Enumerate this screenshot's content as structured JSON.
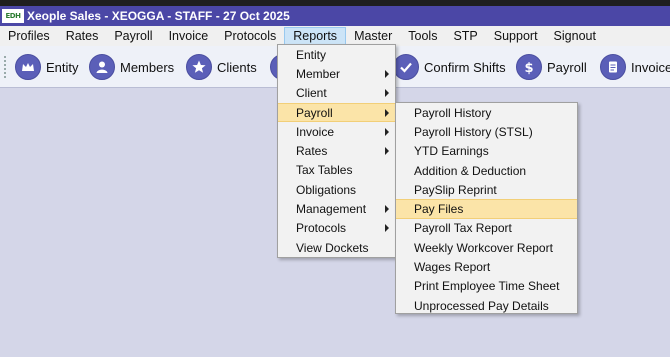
{
  "window": {
    "title": "Xeople Sales - XEOGGA - STAFF - 27 Oct 2025",
    "logo_text": "EDH"
  },
  "menubar": [
    {
      "label": "Profiles"
    },
    {
      "label": "Rates"
    },
    {
      "label": "Payroll"
    },
    {
      "label": "Invoice"
    },
    {
      "label": "Protocols"
    },
    {
      "label": "Reports"
    },
    {
      "label": "Master"
    },
    {
      "label": "Tools"
    },
    {
      "label": "STP"
    },
    {
      "label": "Support"
    },
    {
      "label": "Signout"
    }
  ],
  "toolbar": {
    "entity": "Entity",
    "members": "Members",
    "clients": "Clients",
    "confirm_shifts": "Confirm Shifts",
    "payroll": "Payroll",
    "invoice": "Invoice"
  },
  "reports_menu": [
    {
      "label": "Entity"
    },
    {
      "label": "Member"
    },
    {
      "label": "Client"
    },
    {
      "label": "Payroll"
    },
    {
      "label": "Invoice"
    },
    {
      "label": "Rates"
    },
    {
      "label": "Tax Tables"
    },
    {
      "label": "Obligations"
    },
    {
      "label": "Management"
    },
    {
      "label": "Protocols"
    },
    {
      "label": "View Dockets"
    }
  ],
  "payroll_submenu": [
    {
      "label": "Payroll History"
    },
    {
      "label": "Payroll History (STSL)"
    },
    {
      "label": "YTD Earnings"
    },
    {
      "label": "Addition & Deduction"
    },
    {
      "label": "PaySlip Reprint"
    },
    {
      "label": "Pay Files"
    },
    {
      "label": "Payroll Tax Report"
    },
    {
      "label": "Weekly Workcover Report"
    },
    {
      "label": "Wages Report"
    },
    {
      "label": "Print Employee Time Sheet"
    },
    {
      "label": "Unprocessed Pay Details"
    }
  ],
  "colors": {
    "titlebar": "#4b47a6",
    "highlight": "#fbe4a8",
    "icon": "#5b5fb8"
  }
}
